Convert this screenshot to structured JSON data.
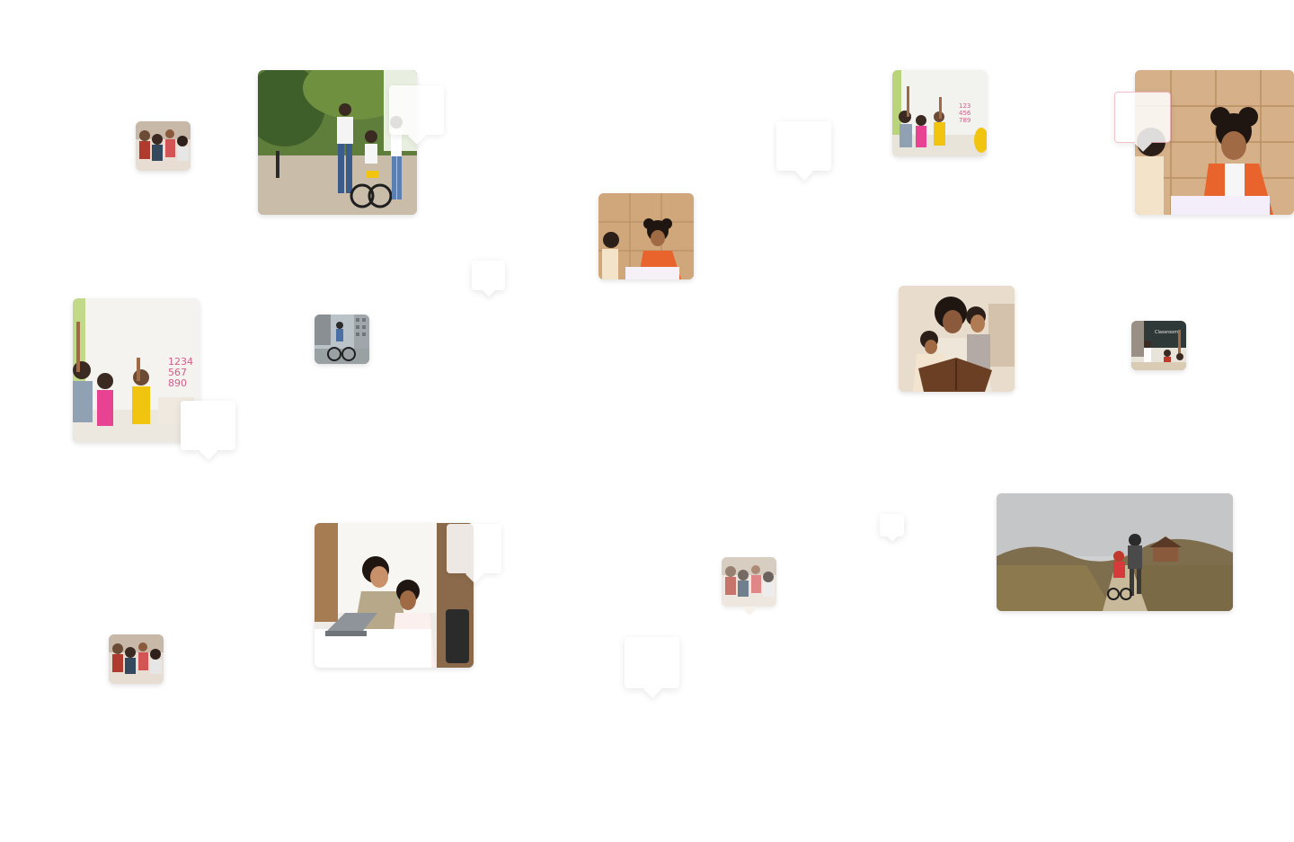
{
  "page": {
    "background": "#ffffff"
  },
  "markers": [
    {
      "id": "m1",
      "kind": "photo",
      "scene": "classroom-group",
      "accent": "#c0392b"
    },
    {
      "id": "m2",
      "kind": "photo",
      "scene": "father-child-bike-park",
      "accent": "#6d8f3a"
    },
    {
      "id": "m3",
      "kind": "blank"
    },
    {
      "id": "m4",
      "kind": "blank"
    },
    {
      "id": "m5",
      "kind": "photo",
      "scene": "girl-drawing-lockers",
      "accent": "#e8642c"
    },
    {
      "id": "m6",
      "kind": "blank"
    },
    {
      "id": "m7",
      "kind": "photo",
      "scene": "kids-raising-hands",
      "accent": "#f1c40f"
    },
    {
      "id": "m8",
      "kind": "photo",
      "scene": "girl-drawing-lockers",
      "accent": "#e8642c"
    },
    {
      "id": "m9",
      "kind": "blank"
    },
    {
      "id": "m10",
      "kind": "photo",
      "scene": "kids-raising-hands",
      "accent": "#e84393"
    },
    {
      "id": "m11",
      "kind": "blank"
    },
    {
      "id": "m12",
      "kind": "photo",
      "scene": "man-cycling-city",
      "accent": "#7f8c8d"
    },
    {
      "id": "m13",
      "kind": "photo",
      "scene": "mother-reading-book",
      "accent": "#8e5a3c"
    },
    {
      "id": "m14",
      "kind": "photo",
      "scene": "teacher-chalkboard",
      "accent": "#2c3e50"
    },
    {
      "id": "m15",
      "kind": "photo",
      "scene": "parent-child-laptop",
      "accent": "#a67c52"
    },
    {
      "id": "m16",
      "kind": "blank"
    },
    {
      "id": "m17",
      "kind": "photo",
      "scene": "classroom-group",
      "accent": "#c0392b"
    },
    {
      "id": "m18",
      "kind": "blank"
    },
    {
      "id": "m19",
      "kind": "photo",
      "scene": "father-child-running-field",
      "accent": "#d35400"
    },
    {
      "id": "m20",
      "kind": "photo",
      "scene": "classroom-group",
      "accent": "#c0392b"
    },
    {
      "id": "m21",
      "kind": "blank"
    }
  ]
}
